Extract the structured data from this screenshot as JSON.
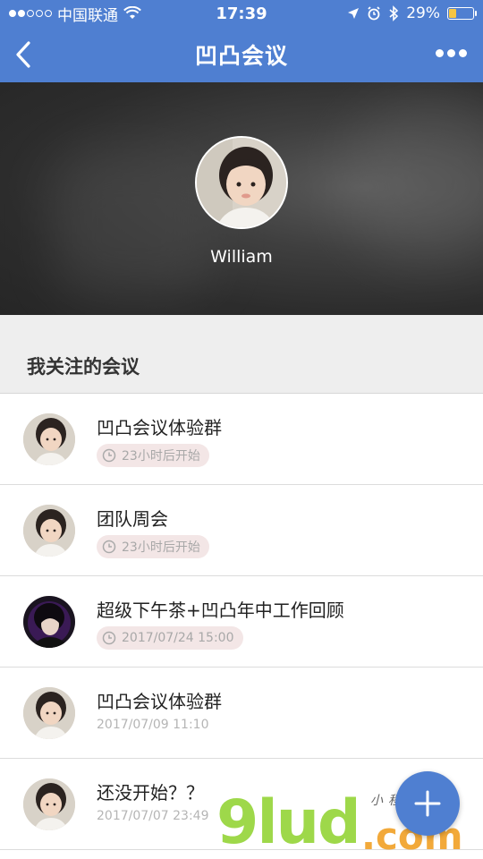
{
  "status_bar": {
    "carrier": "中国联通",
    "time": "17:39",
    "battery_percent": "29%",
    "battery_level": 0.29,
    "signal_dots_filled": 2,
    "signal_dots_total": 5
  },
  "nav": {
    "title": "凹凸会议"
  },
  "profile": {
    "name": "William"
  },
  "section": {
    "title": "我关注的会议"
  },
  "meetings": [
    {
      "title": "凹凸会议体验群",
      "time": "23小时后开始",
      "style": "pill"
    },
    {
      "title": "团队周会",
      "time": "23小时后开始",
      "style": "pill"
    },
    {
      "title": "超级下午茶+凹凸年中工作回顾",
      "time": "2017/07/24 15:00",
      "style": "pill"
    },
    {
      "title": "凹凸会议体验群",
      "time": "2017/07/09 11:10",
      "style": "plain"
    },
    {
      "title": "还没开始？？",
      "time": "2017/07/07 23:49",
      "style": "plain"
    }
  ],
  "watermark": {
    "logo": "9lud",
    "suffix": ".com",
    "tagline": "小程序应用"
  },
  "colors": {
    "accent": "#4f7fd1",
    "pill_bg": "#f3e6e6"
  }
}
